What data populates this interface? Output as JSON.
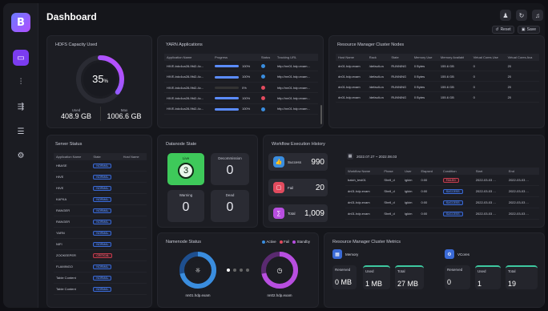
{
  "title": "Dashboard",
  "buttons": {
    "reset": "Reset",
    "save": "Save"
  },
  "hdfs": {
    "title": "HDFS Capacity Used",
    "percent": "35",
    "percent_sign": "%",
    "used_label": "Used",
    "used": "408.9 GB",
    "max_label": "Max",
    "max": "1006.6 GB"
  },
  "yarn": {
    "title": "YARN Applications",
    "columns": [
      "Application Name",
      "Progress",
      "Status",
      "Tracking URL"
    ],
    "rows": [
      {
        "name": "HIVE-bdc4ca28-9fd2-4c...",
        "progress": 100,
        "pct": "100%",
        "status": "#3a8dde",
        "url": "http://nn01.hdp.exam..."
      },
      {
        "name": "HIVE-bdc4ca28-9fd2-4c...",
        "progress": 100,
        "pct": "100%",
        "status": "#3a8dde",
        "url": "http://nn01.hdp.exam..."
      },
      {
        "name": "HIVE-bdc4ca28-9fd2-4c...",
        "progress": 0,
        "pct": "0%",
        "status": "#e24b5e",
        "url": "http://nn01.hdp.exam..."
      },
      {
        "name": "HIVE-bdc4ca28-9fd2-4c...",
        "progress": 100,
        "pct": "100%",
        "status": "#e24b5e",
        "url": "http://nn01.hdp.exam..."
      },
      {
        "name": "HIVE-bdc4ca28-9fd2-4c...",
        "progress": 100,
        "pct": "100%",
        "status": "#3a8dde",
        "url": "http://nn01.hdp.exam..."
      }
    ]
  },
  "rm": {
    "title": "Resource Manager Cluster Nodes",
    "columns": [
      "Host Name",
      "Rack",
      "State",
      "Memory Use",
      "Memory Availabl",
      "Virtual Cores Use",
      "Virtual Cores Ava"
    ],
    "rows": [
      [
        "dn01.hdp.exam",
        "/default-ra",
        "RUNNING",
        "0 Bytes",
        "155.6 GB",
        "0",
        "20"
      ],
      [
        "dn01.hdp.exam",
        "/default-ra",
        "RUNNING",
        "0 Bytes",
        "155.6 GB",
        "0",
        "20"
      ],
      [
        "dn01.hdp.exam",
        "/default-ra",
        "RUNNING",
        "0 Bytes",
        "155.6 GB",
        "0",
        "20"
      ],
      [
        "dn01.hdp.exam",
        "/default-ra",
        "RUNNING",
        "0 Bytes",
        "155.6 GB",
        "0",
        "20"
      ]
    ]
  },
  "server": {
    "title": "Server Status",
    "columns": [
      "Application Name",
      "State",
      "Host Name"
    ],
    "rows": [
      [
        "HBASE",
        "NORMAL"
      ],
      [
        "HIVE",
        "NORMAL"
      ],
      [
        "HIVE",
        "NORMAL"
      ],
      [
        "KAFKA",
        "NORMAL"
      ],
      [
        "RANGER",
        "NORMAL"
      ],
      [
        "RANGER",
        "NORMAL"
      ],
      [
        "YARN",
        "NORMAL"
      ],
      [
        "NIFI",
        "NORMAL"
      ],
      [
        "ZOOKEEPER",
        "CRITICAL"
      ],
      [
        "FLAMINGO",
        "NORMAL"
      ],
      [
        "Table Content",
        "NORMAL"
      ],
      [
        "Table Content",
        "NORMAL"
      ]
    ]
  },
  "datanode": {
    "title": "Datanode State",
    "live_label": "Live",
    "live": "3",
    "decom_label": "Decommission",
    "decom": "0",
    "warning_label": "Warning",
    "warning": "0",
    "dead_label": "Dead",
    "dead": "0"
  },
  "workflow": {
    "title": "Workflow Execution History",
    "success_label": "Success",
    "success": "990",
    "fail_label": "Fail",
    "fail": "20",
    "total_label": "Total",
    "total": "1,009",
    "date_range": "2022.07.27 ~ 2022.08.03",
    "columns": [
      "Workflow Name",
      "Phase",
      "User",
      "Elapsed",
      "Condition",
      "Start",
      "End"
    ],
    "rows": [
      [
        "batch_test01",
        "Shell_d",
        "igkim",
        "0:00",
        "FAILED",
        "2022-03-03 ...",
        "2022-03-03 ..."
      ],
      [
        "dn01.hdp.exam",
        "Shell_d",
        "igkim",
        "0:00",
        "SUCCESS",
        "2022-03-03 ...",
        "2022-03-03 ..."
      ],
      [
        "dn01.hdp.exam",
        "Shell_d",
        "igkim",
        "0:00",
        "SUCCESS",
        "2022-03-03 ...",
        "2022-03-03 ..."
      ],
      [
        "dn01.hdp.exam",
        "Shell_d",
        "igkim",
        "0:00",
        "SUCCESS",
        "2022-03-03 ...",
        "2022-03-03 ..."
      ]
    ]
  },
  "namenode": {
    "title": "Namenode Status",
    "legend": [
      "Active",
      "Fail",
      "Standby"
    ],
    "legend_colors": [
      "#3a8dde",
      "#e24b5e",
      "#b84ee0"
    ],
    "node1": "nn01.hdp.exam",
    "node2": "nn02.hdp.exam"
  },
  "rmm": {
    "title": "Resource Manager Cluster Metrics",
    "memory": "Memory",
    "vcores": "VCores",
    "mem": {
      "reserved_label": "Reserved",
      "reserved": "0 MB",
      "used_label": "Used",
      "used": "1 MB",
      "total_label": "Total",
      "total": "27 MB"
    },
    "vc": {
      "reserved_label": "Reserved",
      "reserved": "0",
      "used_label": "Used",
      "used": "1",
      "total_label": "Total",
      "total": "19"
    }
  },
  "colors": {
    "accent": "#7b3cf0",
    "live": "#3ec95a",
    "success": "#3a8dde",
    "fail": "#e24b5e",
    "total": "#b84ee0"
  }
}
